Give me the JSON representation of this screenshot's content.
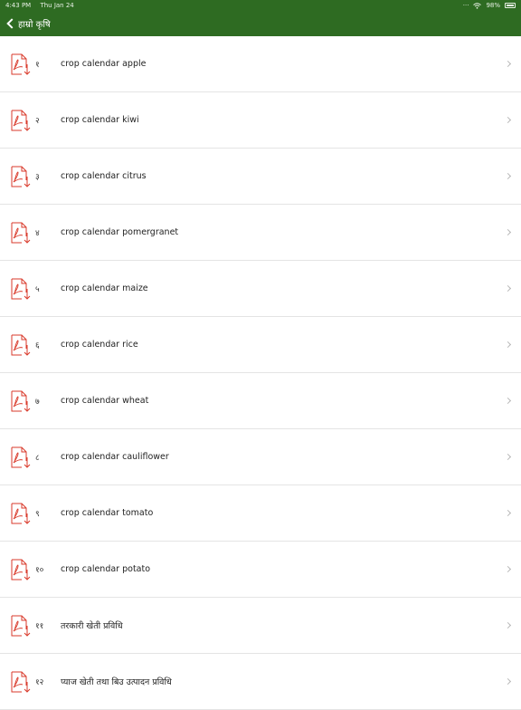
{
  "status_bar": {
    "time": "4:43 PM",
    "date": "Thu Jan 24",
    "battery": "98%",
    "icons": [
      "signal-icon",
      "wifi-icon",
      "battery-icon"
    ]
  },
  "nav": {
    "back_label": "हाम्रो कृषि",
    "back_icon": "chevron-left-icon"
  },
  "colors": {
    "header": "#2e6b22",
    "pdf_icon": "#d93a2b"
  },
  "items": [
    {
      "num": "१",
      "title": "crop calendar apple"
    },
    {
      "num": "२",
      "title": "crop calendar kiwi"
    },
    {
      "num": "३",
      "title": "crop calendar citrus"
    },
    {
      "num": "४",
      "title": "crop calendar pomergranet"
    },
    {
      "num": "५",
      "title": "crop calendar maize"
    },
    {
      "num": "६",
      "title": "crop calendar rice"
    },
    {
      "num": "७",
      "title": "crop calendar wheat"
    },
    {
      "num": "८",
      "title": "crop calendar cauliflower"
    },
    {
      "num": "९",
      "title": "crop calendar tomato"
    },
    {
      "num": "१०",
      "title": "crop calendar potato"
    },
    {
      "num": "११",
      "title": "तरकारी खेती प्रविधि"
    },
    {
      "num": "१२",
      "title": "प्याज खेती तथा बिउ उत्पादन प्रविधि"
    }
  ]
}
